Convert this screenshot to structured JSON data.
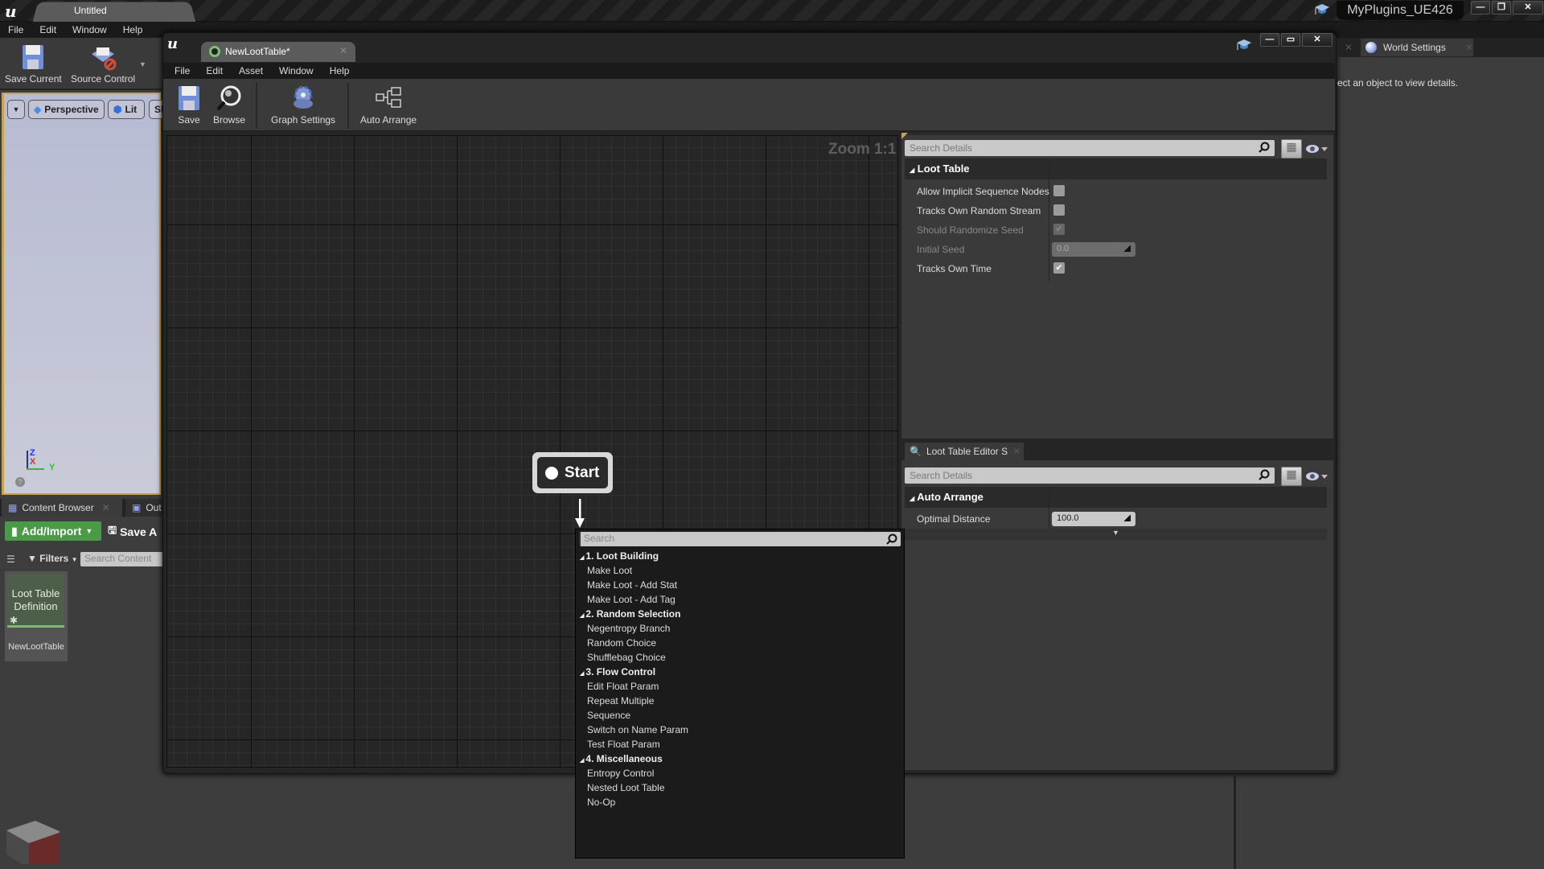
{
  "main_window": {
    "tab_title": "Untitled",
    "project_name": "MyPlugins_UE426",
    "menu": [
      "File",
      "Edit",
      "Window",
      "Help"
    ],
    "toolbar": {
      "save_current": "Save Current",
      "source_control": "Source Control"
    },
    "window_buttons": {
      "minimize": "—",
      "restore": "❐",
      "close": "✕"
    }
  },
  "viewport": {
    "perspective_label": "Perspective",
    "lit_label": "Lit",
    "show_label": "Sh",
    "axis": {
      "z": "Z",
      "x": "X",
      "y": "Y"
    }
  },
  "content_browser": {
    "tab_label": "Content Browser",
    "output_tab_label": "Out",
    "add_import_label": "Add/Import",
    "save_all_label": "Save A",
    "filters_label": "Filters",
    "search_placeholder": "Search Content",
    "asset": {
      "type_label": "Loot Table Definition",
      "name": "NewLootTable"
    }
  },
  "editor": {
    "tab_title": "NewLootTable*",
    "menu": [
      "File",
      "Edit",
      "Asset",
      "Window",
      "Help"
    ],
    "toolbar": {
      "save": "Save",
      "browse": "Browse",
      "graph_settings": "Graph Settings",
      "auto_arrange": "Auto Arrange"
    },
    "window_buttons": {
      "minimize": "—",
      "restore": "▭",
      "close": "✕"
    },
    "graph": {
      "zoom_label": "Zoom 1:1",
      "start_node_label": "Start"
    }
  },
  "details_panel": {
    "search_placeholder": "Search Details",
    "category": "Loot Table",
    "properties": [
      {
        "label": "Allow Implicit Sequence Nodes",
        "type": "checkbox",
        "checked": false,
        "disabled": false
      },
      {
        "label": "Tracks Own Random Stream",
        "type": "checkbox",
        "checked": false,
        "disabled": false
      },
      {
        "label": "Should Randomize Seed",
        "type": "checkbox",
        "checked": true,
        "disabled": true
      },
      {
        "label": "Initial Seed",
        "type": "number",
        "value": "0.0",
        "disabled": true
      },
      {
        "label": "Tracks Own Time",
        "type": "checkbox",
        "checked": true,
        "disabled": false
      }
    ]
  },
  "editor_settings_panel": {
    "tab_label": "Loot Table Editor S",
    "search_placeholder": "Search Details",
    "category": "Auto Arrange",
    "properties": [
      {
        "label": "Optimal Distance",
        "type": "number",
        "value": "100.0"
      }
    ]
  },
  "world_settings": {
    "tab_label": "World Settings",
    "message": "ect an object to view details."
  },
  "node_menu": {
    "search_placeholder": "Search",
    "categories": [
      {
        "label": "1. Loot Building",
        "items": [
          "Make Loot",
          "Make Loot - Add Stat",
          "Make Loot - Add Tag"
        ]
      },
      {
        "label": "2. Random Selection",
        "items": [
          "Negentropy Branch",
          "Random Choice",
          "Shufflebag Choice"
        ]
      },
      {
        "label": "3. Flow Control",
        "items": [
          "Edit Float Param",
          "Repeat Multiple",
          "Sequence",
          "Switch on Name Param",
          "Test Float Param"
        ]
      },
      {
        "label": "4. Miscellaneous",
        "items": [
          "Entropy Control",
          "Nested Loot Table",
          "No-Op"
        ]
      }
    ]
  }
}
